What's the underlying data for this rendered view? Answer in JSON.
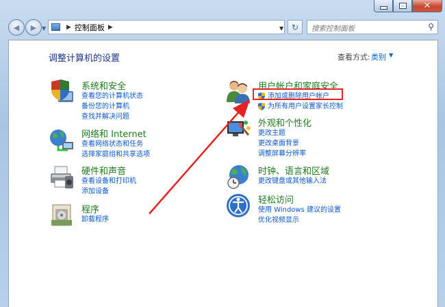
{
  "window": {
    "close_glyph": "✕"
  },
  "navigation": {
    "back_glyph": "◀",
    "forward_glyph": "▶",
    "breadcrumb": "控制面板",
    "refresh_glyph": "↻",
    "search_placeholder": "搜索控制面板",
    "search_icon": "magnifier-icon"
  },
  "main": {
    "title": "调整计算机的设置",
    "view_by_label": "查看方式:",
    "view_by_value": "类别"
  },
  "left_categories": [
    {
      "title": "系统和安全",
      "icon": "shield-computer-icon",
      "links": [
        "查看您的计算机状态",
        "备份您的计算机",
        "查找并解决问题"
      ]
    },
    {
      "title": "网络和 Internet",
      "icon": "network-globe-icon",
      "links": [
        "查看网络状态和任务",
        "选择家庭组和共享选项"
      ]
    },
    {
      "title": "硬件和声音",
      "icon": "printer-icon",
      "links": [
        "查看设备和打印机",
        "添加设备"
      ]
    },
    {
      "title": "程序",
      "icon": "programs-box-icon",
      "links": [
        "卸载程序"
      ]
    }
  ],
  "right_categories": [
    {
      "title": "用户帐户和家庭安全",
      "icon": "users-icon",
      "links": [
        "添加或删除用户帐户",
        "为所有用户设置家长控制"
      ]
    },
    {
      "title": "外观和个性化",
      "icon": "display-paint-icon",
      "links": [
        "更改主题",
        "更改桌面背景",
        "调整屏幕分辨率"
      ]
    },
    {
      "title": "时钟、语言和区域",
      "icon": "globe-clock-icon",
      "links": [
        "更改键盘或其他输入法"
      ]
    },
    {
      "title": "轻松访问",
      "icon": "ease-of-access-icon",
      "links": [
        "使用 Windows 建议的设置",
        "优化视频显示"
      ]
    }
  ],
  "annotation": {
    "highlight_color": "#e62222",
    "arrow_color": "#e62222"
  },
  "colors": {
    "link": "#0b57d0",
    "category_title": "#1e7a1e",
    "page_title": "#1e3287"
  }
}
